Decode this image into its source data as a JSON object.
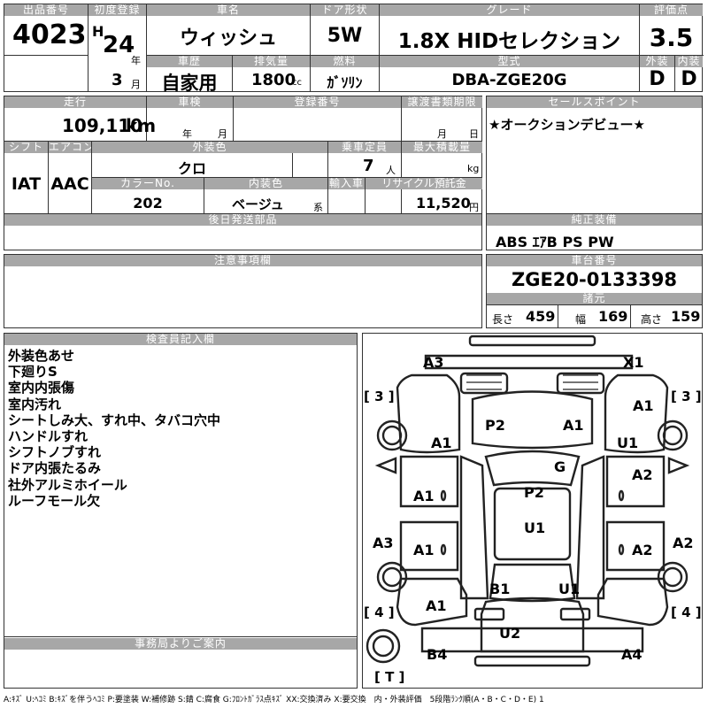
{
  "header": {
    "lot_no_label": "出品番号",
    "lot_no": "4023",
    "first_reg_label": "初度登録",
    "era": "H",
    "reg_year": "24",
    "year_unit": "年",
    "reg_month": "3",
    "month_unit": "月",
    "car_name_label": "車名",
    "car_name": "ウィッシュ",
    "doors_label": "ドア形状",
    "doors": "5W",
    "grade_label": "グレード",
    "grade": "1.8X HIDセレクション",
    "score_label": "評価点",
    "score": "3.5",
    "history_label": "車歴",
    "history": "自家用",
    "displacement_label": "排気量",
    "displacement": "1800",
    "displacement_unit": "cc",
    "fuel_label": "燃料",
    "fuel": "ｶﾞｿﾘﾝ",
    "model_label": "型式",
    "model": "DBA-ZGE20G",
    "ext_label": "外装",
    "ext_grade": "D",
    "int_label": "内装",
    "int_grade": "D"
  },
  "mid": {
    "mileage_label": "走行",
    "mileage": "109,110",
    "mileage_unit": "km",
    "inspection_label": "車検",
    "insp_year_unit": "年",
    "insp_month_unit": "月",
    "reg_no_label": "登録番号",
    "transfer_label": "譲渡書類期限",
    "transfer_month_unit": "月",
    "transfer_day_unit": "日",
    "sales_point_label": "セールスポイント",
    "sales_point": "★オークションデビュー★",
    "shift_label": "シフト",
    "shift": "IAT",
    "ac_label": "エアコン",
    "ac": "AAC",
    "ext_color_label": "外装色",
    "ext_color": "クロ",
    "capacity_label": "乗車定員",
    "capacity": "7",
    "capacity_unit": "人",
    "max_load_label": "最大積載量",
    "max_load_unit": "kg",
    "color_no_label": "カラーNo.",
    "color_no": "202",
    "int_color_label": "内装色",
    "int_color": "ベージュ",
    "int_color_unit": "系",
    "import_label": "輸入車",
    "recycle_label": "リサイクル預託金",
    "recycle": "11,520",
    "recycle_unit": "円",
    "later_parts_label": "後日発送部品",
    "equip_label": "純正装備",
    "equip": "ABS ｴｱB PS PW",
    "notes_label": "注意事項欄",
    "chassis_label": "車台番号",
    "chassis": "ZGE20-0133398",
    "specs_label": "諸元",
    "length_label": "長さ",
    "length": "459",
    "width_label": "幅",
    "width": "169",
    "height_label": "高さ",
    "height": "159"
  },
  "inspector": {
    "label": "検査員記入欄",
    "lines": [
      "外装色あせ",
      "下廻りS",
      "室内内張傷",
      "室内汚れ",
      "シートしみ大、すれ中、タバコ穴中",
      "ハンドルすれ",
      "シフトノブすれ",
      "ドア内張たるみ",
      "社外アルミホイール",
      "ルーフモール欠"
    ]
  },
  "office": {
    "label": "事務局よりご案内"
  },
  "diagram": {
    "tire_marks": [
      "3",
      "3",
      "4",
      "4",
      "T"
    ],
    "damage": {
      "front_left": "A3",
      "front_right": "X1",
      "fender_right": "A1",
      "hood_left": "P2",
      "hood_right": "A1",
      "fender_left": "A1",
      "pillar_right": "U1",
      "windshield": "G",
      "door_fl": "A1",
      "roof": "P2",
      "door_fr": "A2",
      "roof_rear": "U1",
      "quarter_left": "A3",
      "door_rl": "A1",
      "door_rr": "A2",
      "quarter_right": "A2",
      "trunk_left": "B1",
      "trunk_right": "U1",
      "quarter_rear_left": "A1",
      "rear_bumper": "U2",
      "rear_left": "B4",
      "rear_right": "A4"
    }
  },
  "legend": "A:ｷｽﾞ U:ﾍｺﾐ B:ｷｽﾞを伴うﾍｺﾐ P:要塗装 W:補修跡 S:錆 C:腐食 G:ﾌﾛﾝﾄｶﾞﾗｽ点ｷｽﾞ XX:交換済み X:要交換　内・外装評価　5段階ﾗﾝｸ順(A・B・C・D・E) 1"
}
